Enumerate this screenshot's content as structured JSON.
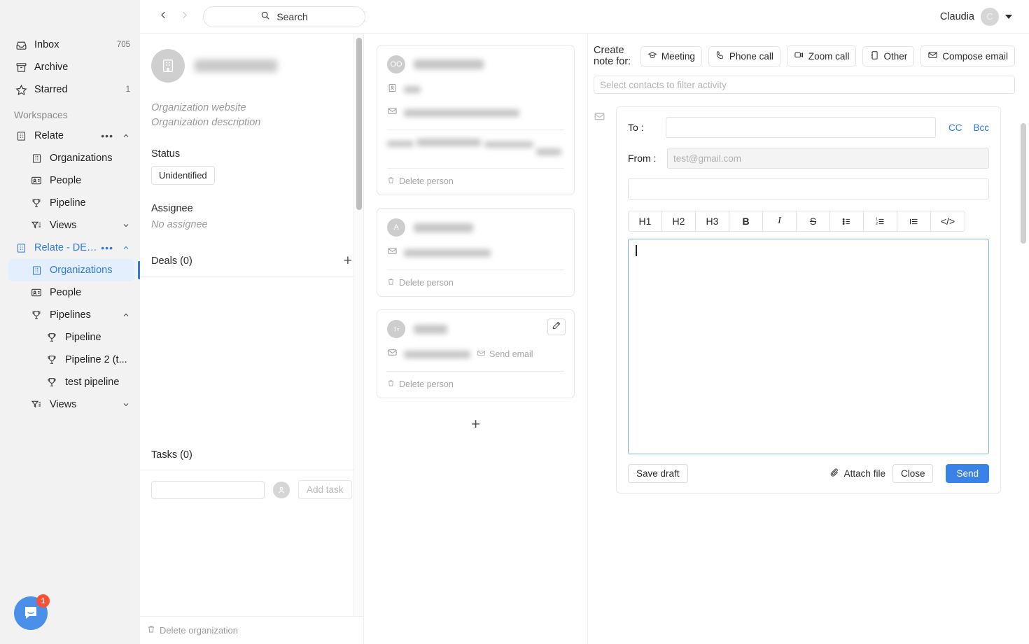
{
  "topbar": {
    "back_icon": "chevron-left-icon",
    "forward_icon": "chevron-right-icon",
    "search_placeholder": "Search",
    "search_label": "Search",
    "user_name": "Claudia",
    "user_initial": "C"
  },
  "sidebar": {
    "primary": [
      {
        "label": "Inbox",
        "count": "705",
        "icon": "inbox-icon"
      },
      {
        "label": "Archive",
        "count": "",
        "icon": "archive-icon"
      },
      {
        "label": "Starred",
        "count": "1",
        "icon": "star-icon"
      }
    ],
    "section_label": "Workspaces",
    "workspaces": [
      {
        "label": "Relate",
        "icon": "building-icon",
        "dots": "•••",
        "items": [
          {
            "label": "Organizations",
            "icon": "building-icon"
          },
          {
            "label": "People",
            "icon": "contact-card-icon"
          },
          {
            "label": "Pipeline",
            "icon": "trophy-icon"
          },
          {
            "label": "Views",
            "icon": "filter-icon"
          }
        ]
      },
      {
        "label": "Relate - DEMO",
        "icon": "building-icon",
        "dots": "•••",
        "items": [
          {
            "label": "Organizations",
            "icon": "building-icon"
          },
          {
            "label": "People",
            "icon": "contact-card-icon"
          },
          {
            "label": "Pipelines",
            "icon": "trophy-icon"
          },
          {
            "label": "Pipeline",
            "icon": "trophy-icon"
          },
          {
            "label": "Pipeline 2 (t...",
            "icon": "trophy-icon"
          },
          {
            "label": "test pipeline",
            "icon": "trophy-icon"
          },
          {
            "label": "Views",
            "icon": "filter-icon"
          }
        ]
      }
    ],
    "chat_badge": "1"
  },
  "organization": {
    "name": "",
    "website_placeholder": "Organization website",
    "description_placeholder": "Organization description",
    "status_label": "Status",
    "status_value": "Unidentified",
    "assignee_label": "Assignee",
    "assignee_value": "No assignee",
    "deals_title": "Deals (0)",
    "tasks_title": "Tasks (0)",
    "task_input_value": "",
    "add_task_label": "Add task",
    "delete_label": "Delete organization"
  },
  "people": {
    "cards": [
      {
        "initials": "OO",
        "name": "",
        "role_value": "",
        "email": "",
        "extra_lines": [
          "",
          "",
          "",
          ""
        ],
        "delete_label": "Delete person",
        "has_edit": false,
        "send_email_label": ""
      },
      {
        "initials": "A",
        "name": "",
        "email": "",
        "delete_label": "Delete person",
        "has_edit": false,
        "send_email_label": ""
      },
      {
        "initials": "",
        "name": "",
        "email": "",
        "delete_label": "Delete person",
        "has_edit": true,
        "send_email_label": "Send email"
      }
    ],
    "add_person_label": "+"
  },
  "activity": {
    "create_note_label": "Create note for:",
    "note_types": [
      {
        "label": "Meeting",
        "icon": "meeting-icon"
      },
      {
        "label": "Phone call",
        "icon": "phone-icon"
      },
      {
        "label": "Zoom call",
        "icon": "video-icon"
      },
      {
        "label": "Other",
        "icon": "notebook-icon"
      }
    ],
    "compose_email_label": "Compose email",
    "filter_placeholder": "Select contacts to filter activity"
  },
  "composer": {
    "to_label": "To :",
    "to_value": "",
    "cc_label": "CC",
    "bcc_label": "Bcc",
    "from_label": "From :",
    "from_placeholder": "test@gmail.com",
    "from_value": "",
    "subject_value": "",
    "subject_placeholder": "",
    "toolbar": [
      {
        "label": "H1",
        "name": "heading-1-button"
      },
      {
        "label": "H2",
        "name": "heading-2-button"
      },
      {
        "label": "H3",
        "name": "heading-3-button"
      },
      {
        "label": "B",
        "name": "bold-button"
      },
      {
        "label": "I",
        "name": "italic-button"
      },
      {
        "label": "S",
        "name": "strikethrough-button"
      },
      {
        "label": "☰",
        "name": "bullet-list-button"
      },
      {
        "label": "≡",
        "name": "numbered-list-button"
      },
      {
        "label": "≣",
        "name": "blockquote-button"
      },
      {
        "label": "</>",
        "name": "code-block-button"
      }
    ],
    "body_value": "",
    "save_draft_label": "Save draft",
    "attach_file_label": "Attach file",
    "close_label": "Close",
    "send_label": "Send"
  },
  "colors": {
    "accent": "#2f7ae5",
    "send_button": "#3b82e8",
    "badge_red": "#ff4e33",
    "sidebar_bg": "#f2f2f2"
  }
}
